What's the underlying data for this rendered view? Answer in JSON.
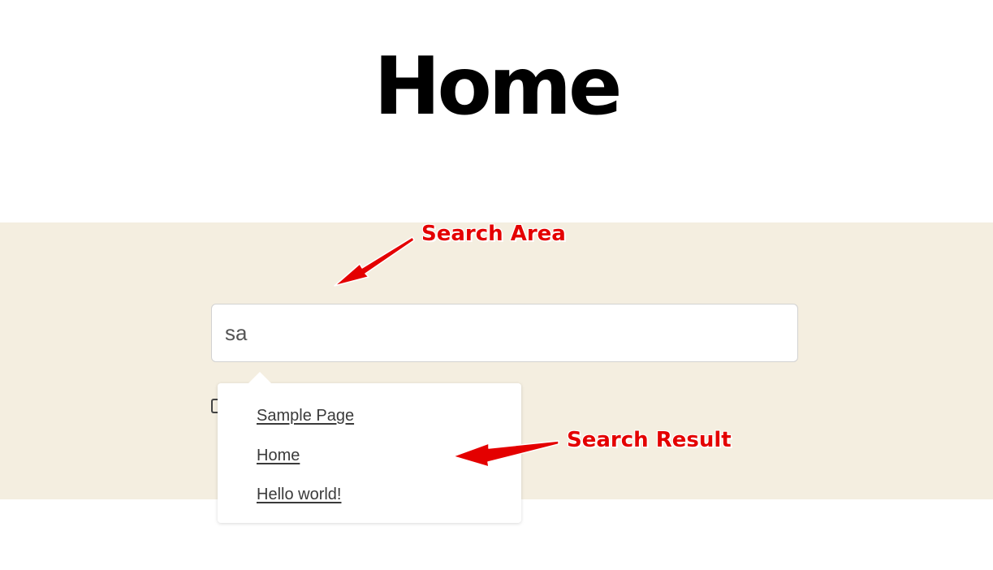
{
  "page": {
    "title": "Home"
  },
  "search": {
    "value": "sa"
  },
  "results": [
    {
      "label": "Sample Page"
    },
    {
      "label": "Home"
    },
    {
      "label": "Hello world!"
    }
  ],
  "annotations": {
    "search_area": "Search Area",
    "search_result": "Search Result",
    "color": "#e40000"
  },
  "colors": {
    "band_background": "#f4eee0",
    "title_text": "#000000"
  }
}
